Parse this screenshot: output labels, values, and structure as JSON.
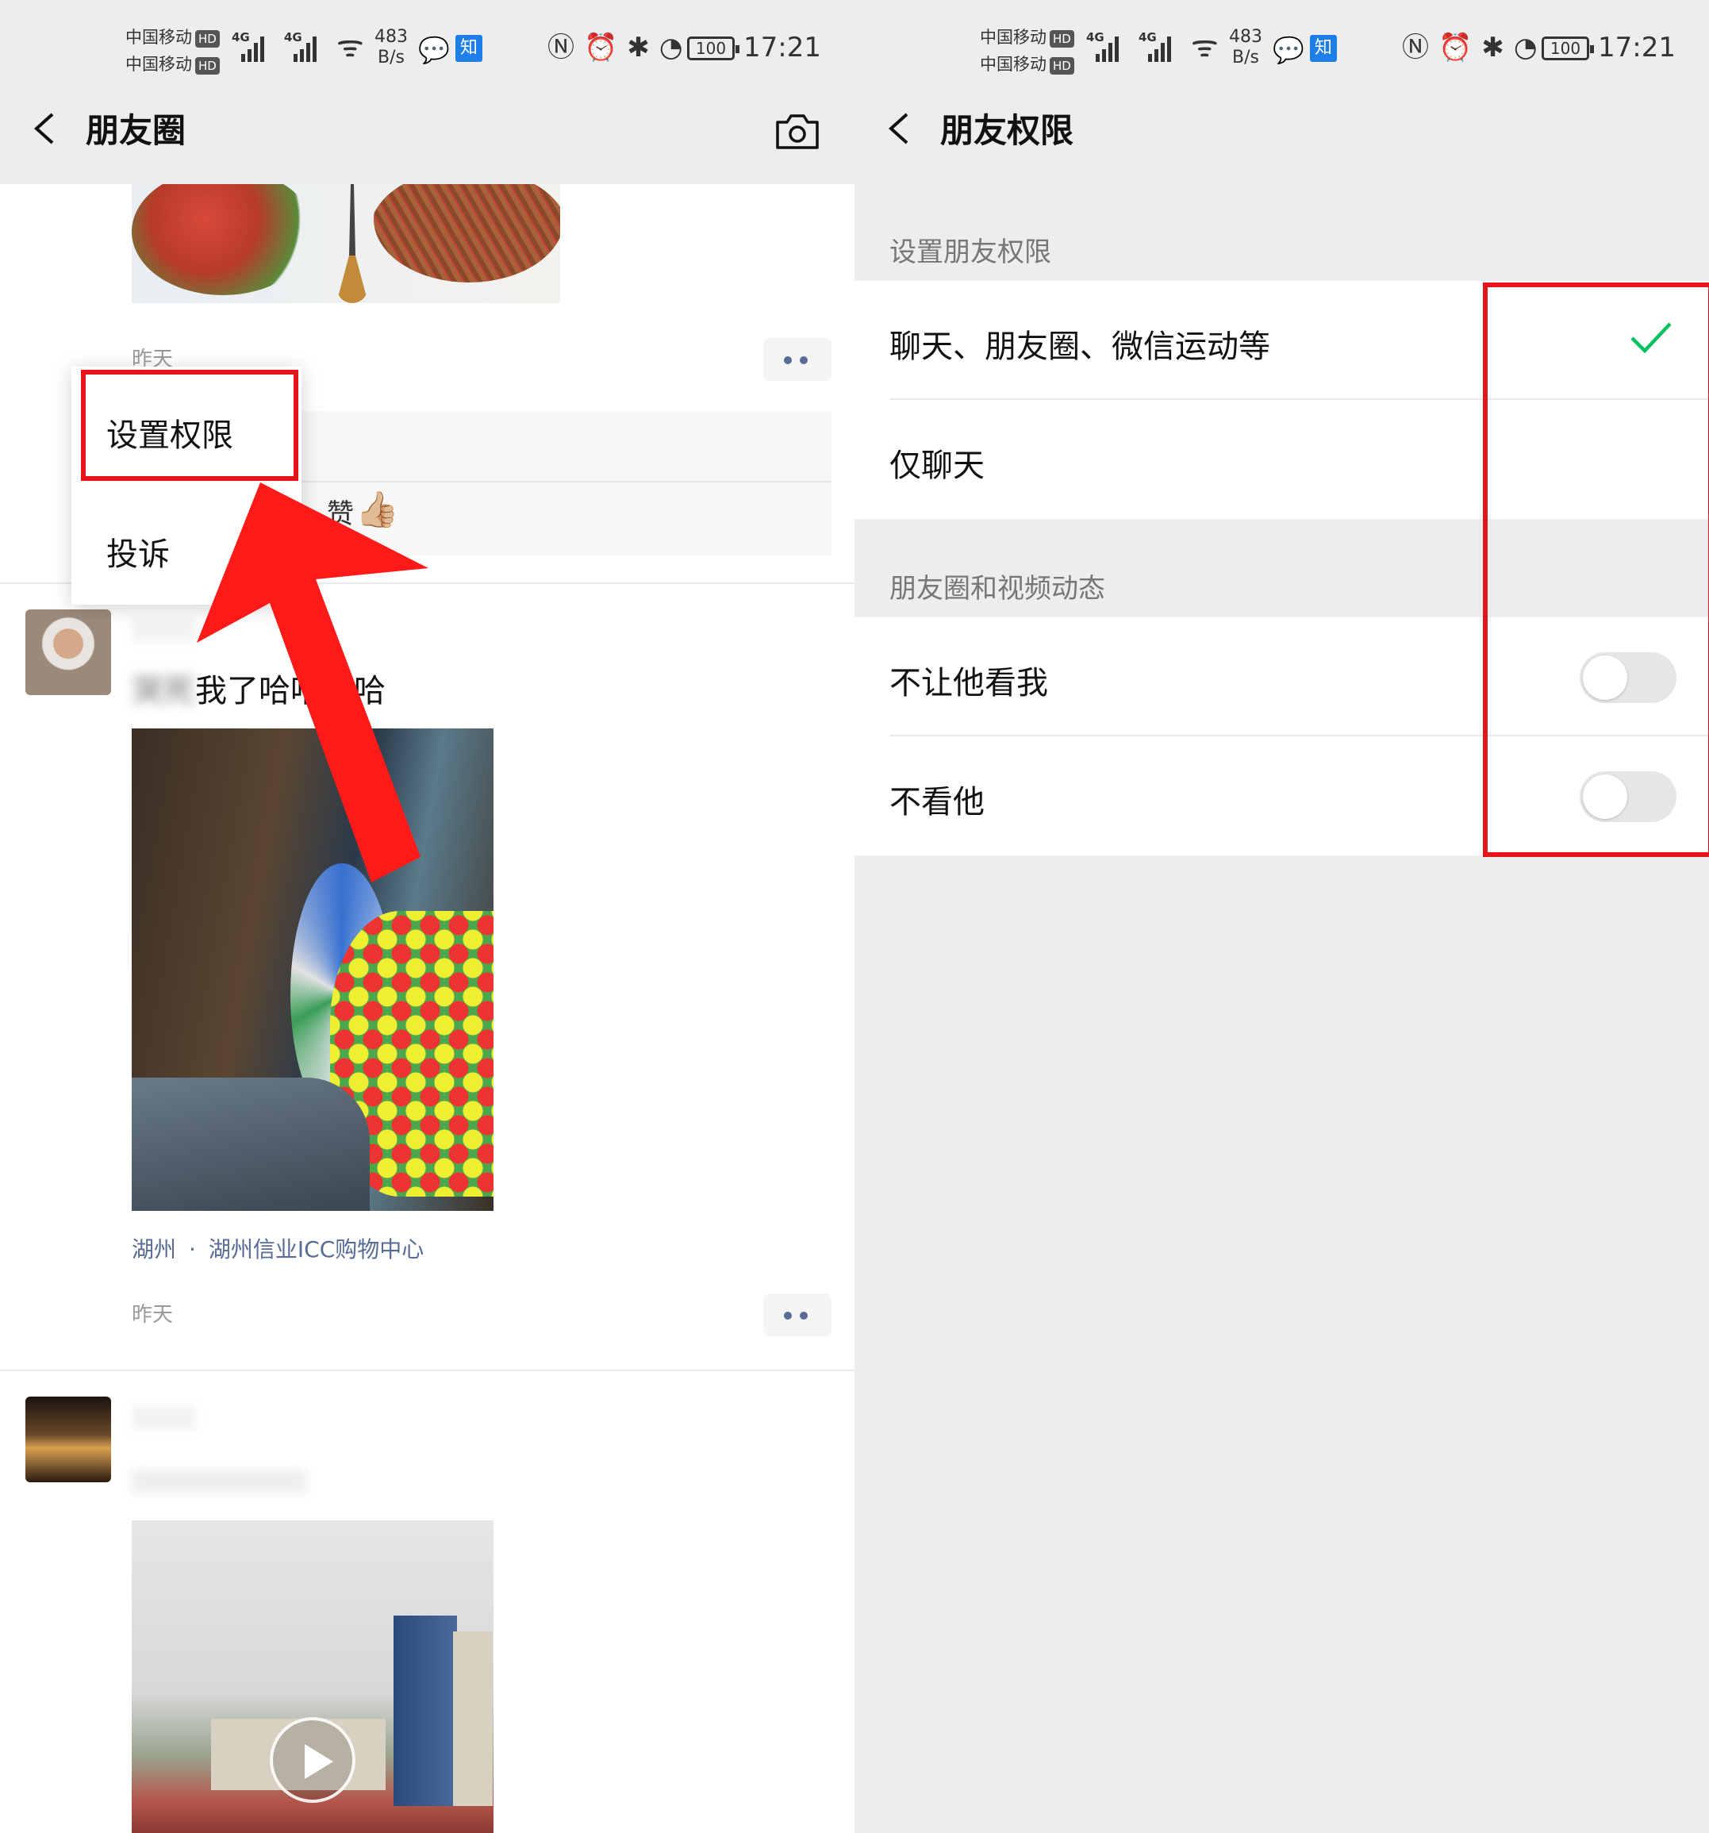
{
  "status_bar": {
    "carrier_1": "中国移动",
    "carrier_2": "中国移动",
    "hd_badge": "HD",
    "network": "4G",
    "speed_value": "483",
    "speed_unit": "B/s",
    "zhihu_badge": "知",
    "battery": "100",
    "time": "17:21"
  },
  "left_screen": {
    "title": "朋友圈",
    "posts": [
      {
        "time": "昨天",
        "likes_text": "赞",
        "like_emoji": "👍🏼"
      },
      {
        "text_visible": "我了哈哈哈哈",
        "location_city": "湖州",
        "location_dot": "·",
        "location_place": "湖州信业ICC购物中心",
        "time": "昨天"
      }
    ],
    "popup_menu": {
      "items": [
        "设置权限",
        "投诉"
      ]
    }
  },
  "right_screen": {
    "title": "朋友权限",
    "section_1_label": "设置朋友权限",
    "options": [
      {
        "label": "聊天、朋友圈、微信运动等",
        "selected": true
      },
      {
        "label": "仅聊天",
        "selected": false
      }
    ],
    "section_2_label": "朋友圈和视频动态",
    "toggles": [
      {
        "label": "不让他看我",
        "on": false
      },
      {
        "label": "不看他",
        "on": false
      }
    ]
  },
  "colors": {
    "highlight_red": "#e5151c",
    "wechat_green": "#07c160",
    "link_blue": "#576b95"
  }
}
